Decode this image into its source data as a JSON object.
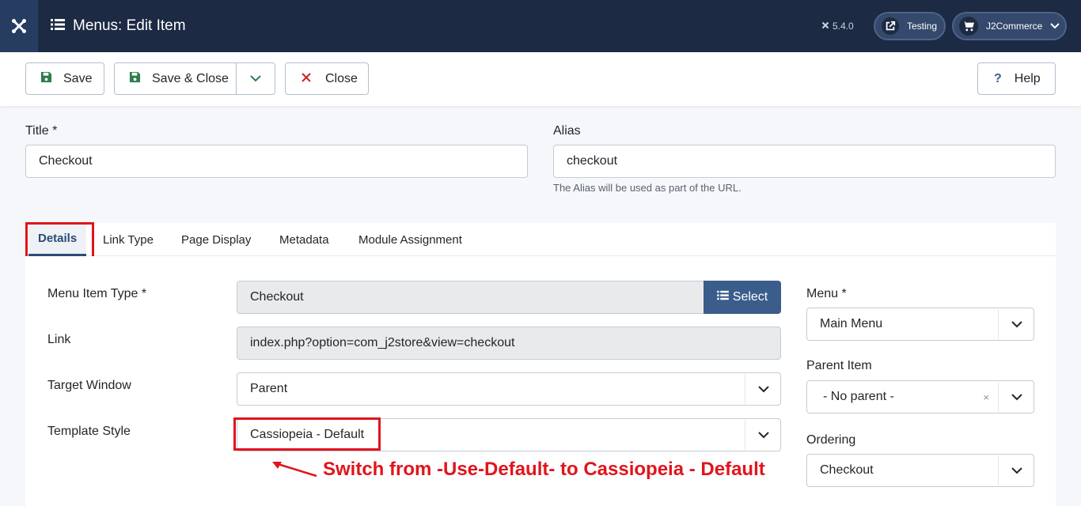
{
  "header": {
    "title": "Menus: Edit Item",
    "version": "5.4.0",
    "site_button": "Testing",
    "user_button": "J2Commerce"
  },
  "toolbar": {
    "save": "Save",
    "save_close": "Save & Close",
    "close": "Close",
    "help": "Help"
  },
  "form": {
    "title_label": "Title *",
    "title_value": "Checkout",
    "alias_label": "Alias",
    "alias_value": "checkout",
    "alias_hint": "The Alias will be used as part of the URL."
  },
  "tabs": [
    "Details",
    "Link Type",
    "Page Display",
    "Metadata",
    "Module Assignment"
  ],
  "details": {
    "menu_item_type_label": "Menu Item Type *",
    "menu_item_type_value": "Checkout",
    "select_button": "Select",
    "link_label": "Link",
    "link_value": "index.php?option=com_j2store&view=checkout",
    "target_window_label": "Target Window",
    "target_window_value": "Parent",
    "template_style_label": "Template Style",
    "template_style_value": "Cassiopeia - Default"
  },
  "sidebar": {
    "menu_label": "Menu *",
    "menu_value": "Main Menu",
    "parent_item_label": "Parent Item",
    "parent_item_value": "- No parent -",
    "ordering_label": "Ordering",
    "ordering_value": "Checkout"
  },
  "annotation": "Switch from -Use-Default- to Cassiopeia - Default",
  "colors": {
    "header_bg": "#1c2a44",
    "accent": "#3a5d8b",
    "highlight": "#e1141c"
  }
}
